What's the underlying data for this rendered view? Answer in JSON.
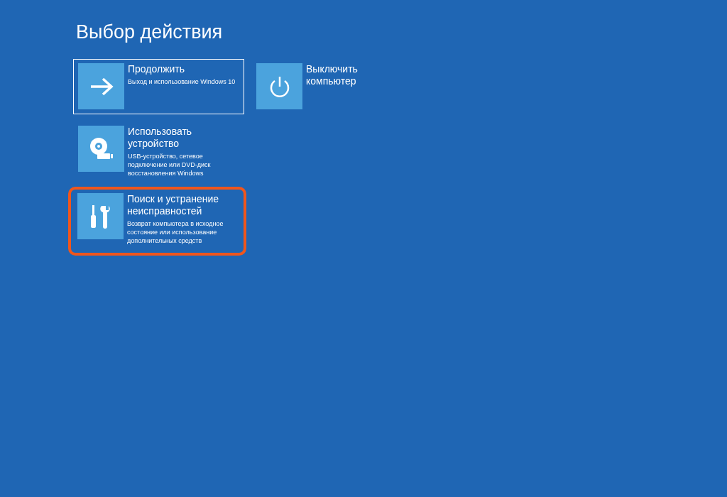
{
  "title": "Выбор действия",
  "options": [
    {
      "kind": "arrow",
      "title": "Продолжить",
      "description": "Выход и использование Windows 10",
      "selected": true,
      "highlighted": false
    },
    {
      "kind": "power",
      "title": "Выключить компьютер",
      "selected": false,
      "highlighted": false
    },
    {
      "kind": "disc",
      "title": "Использовать устройство",
      "description": "USB-устройство, сетевое подключение или DVD-диск восстановления Windows",
      "selected": false,
      "highlighted": false
    },
    {
      "kind": "tools",
      "title": "Поиск и устранение неисправностей",
      "description": "Возврат компьютера в исходное состояние или использование дополнительных средств",
      "selected": false,
      "highlighted": true
    }
  ]
}
